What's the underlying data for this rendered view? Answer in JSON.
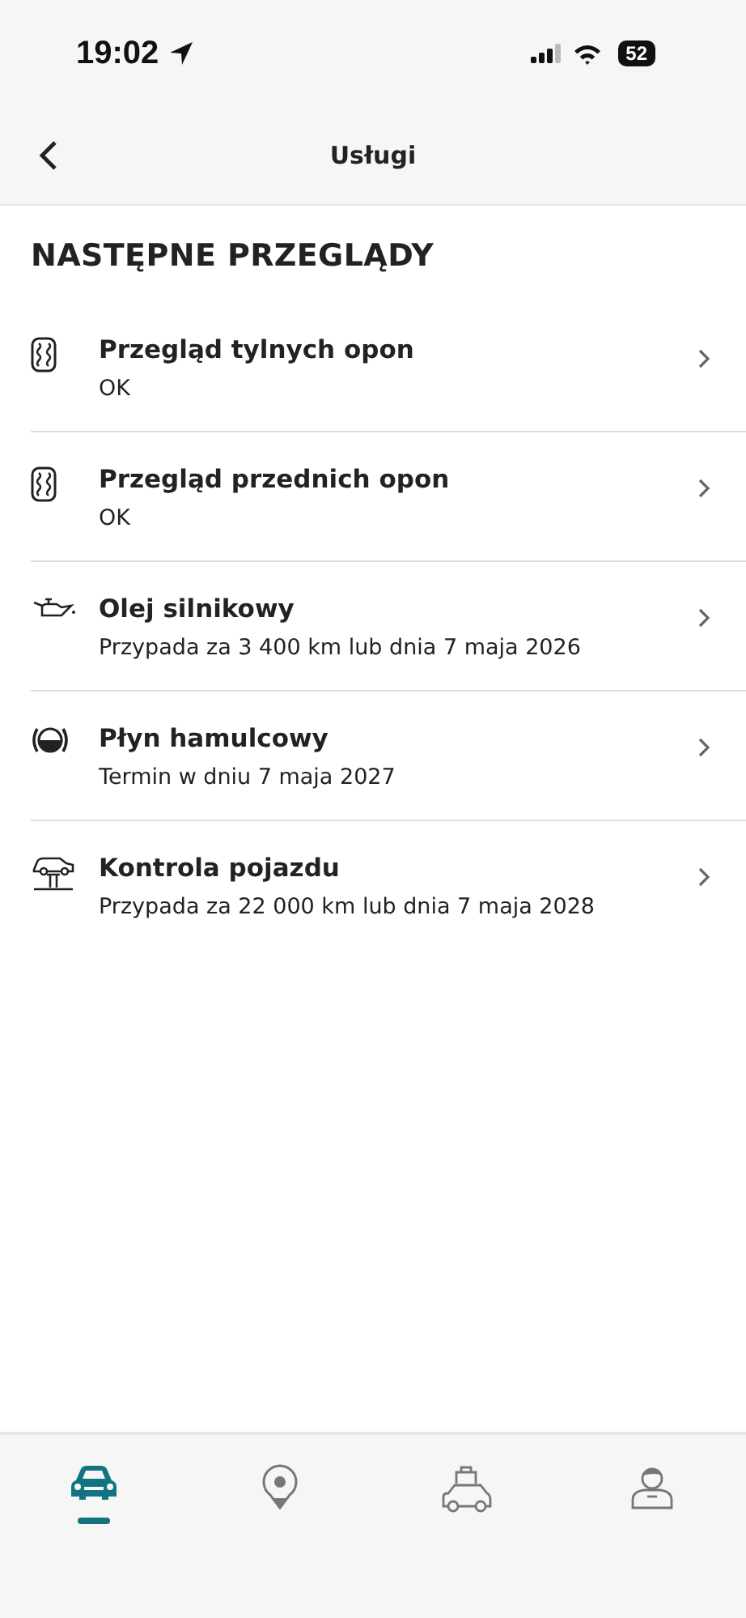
{
  "status_bar": {
    "time": "19:02",
    "battery": "52"
  },
  "header": {
    "title": "Usługi"
  },
  "section_title": "NASTĘPNE PRZEGLĄDY",
  "services": [
    {
      "kind": "tire",
      "title": "Przegląd tylnych opon",
      "detail": "OK"
    },
    {
      "kind": "tire",
      "title": "Przegląd przednich opon",
      "detail": "OK"
    },
    {
      "kind": "oil",
      "title": "Olej silnikowy",
      "detail": "Przypada za 3 400 km lub dnia 7 maja 2026"
    },
    {
      "kind": "brake",
      "title": "Płyn hamulcowy",
      "detail": "Termin w dniu 7 maja 2027"
    },
    {
      "kind": "lift",
      "title": "Kontrola pojazdu",
      "detail": "Przypada za 22 000 km lub dnia 7 maja 2028"
    }
  ],
  "tabs": [
    {
      "kind": "car",
      "selected": true
    },
    {
      "kind": "pin",
      "selected": false
    },
    {
      "kind": "taxi",
      "selected": false
    },
    {
      "kind": "person",
      "selected": false
    }
  ]
}
